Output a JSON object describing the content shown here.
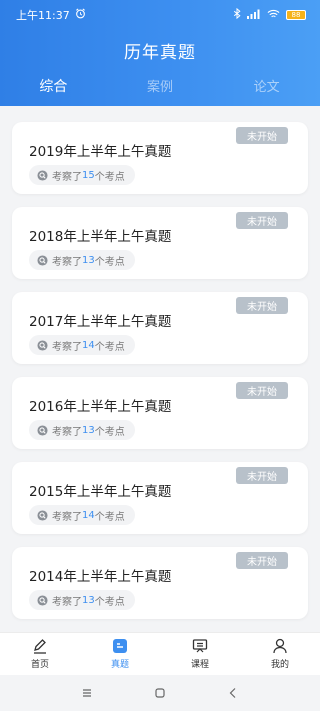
{
  "statusbar": {
    "time": "上午11:37",
    "signal": ".ill",
    "battery": "88"
  },
  "header": {
    "title": "历年真题"
  },
  "tabs": [
    {
      "label": "综合",
      "active": true
    },
    {
      "label": "案例",
      "active": false
    },
    {
      "label": "论文",
      "active": false
    }
  ],
  "exams": [
    {
      "title": "2019年上半年上午真题",
      "status": "未开始",
      "prefix": "考察了",
      "count": "15",
      "suffix": "个考点"
    },
    {
      "title": "2018年上半年上午真题",
      "status": "未开始",
      "prefix": "考察了",
      "count": "13",
      "suffix": "个考点"
    },
    {
      "title": "2017年上半年上午真题",
      "status": "未开始",
      "prefix": "考察了",
      "count": "14",
      "suffix": "个考点"
    },
    {
      "title": "2016年上半年上午真题",
      "status": "未开始",
      "prefix": "考察了",
      "count": "13",
      "suffix": "个考点"
    },
    {
      "title": "2015年上半年上午真题",
      "status": "未开始",
      "prefix": "考察了",
      "count": "14",
      "suffix": "个考点"
    },
    {
      "title": "2014年上半年上午真题",
      "status": "未开始",
      "prefix": "考察了",
      "count": "13",
      "suffix": "个考点"
    }
  ],
  "bottom_nav": [
    {
      "label": "首页",
      "icon": "pen-icon",
      "active": false
    },
    {
      "label": "真题",
      "icon": "document-icon",
      "active": true
    },
    {
      "label": "课程",
      "icon": "course-icon",
      "active": false
    },
    {
      "label": "我的",
      "icon": "user-icon",
      "active": false
    }
  ],
  "system_nav": [
    "menu-icon",
    "home-icon",
    "back-icon"
  ],
  "colors": {
    "accent": "#3d8ff0",
    "status_badge": "#b8c1ca"
  }
}
